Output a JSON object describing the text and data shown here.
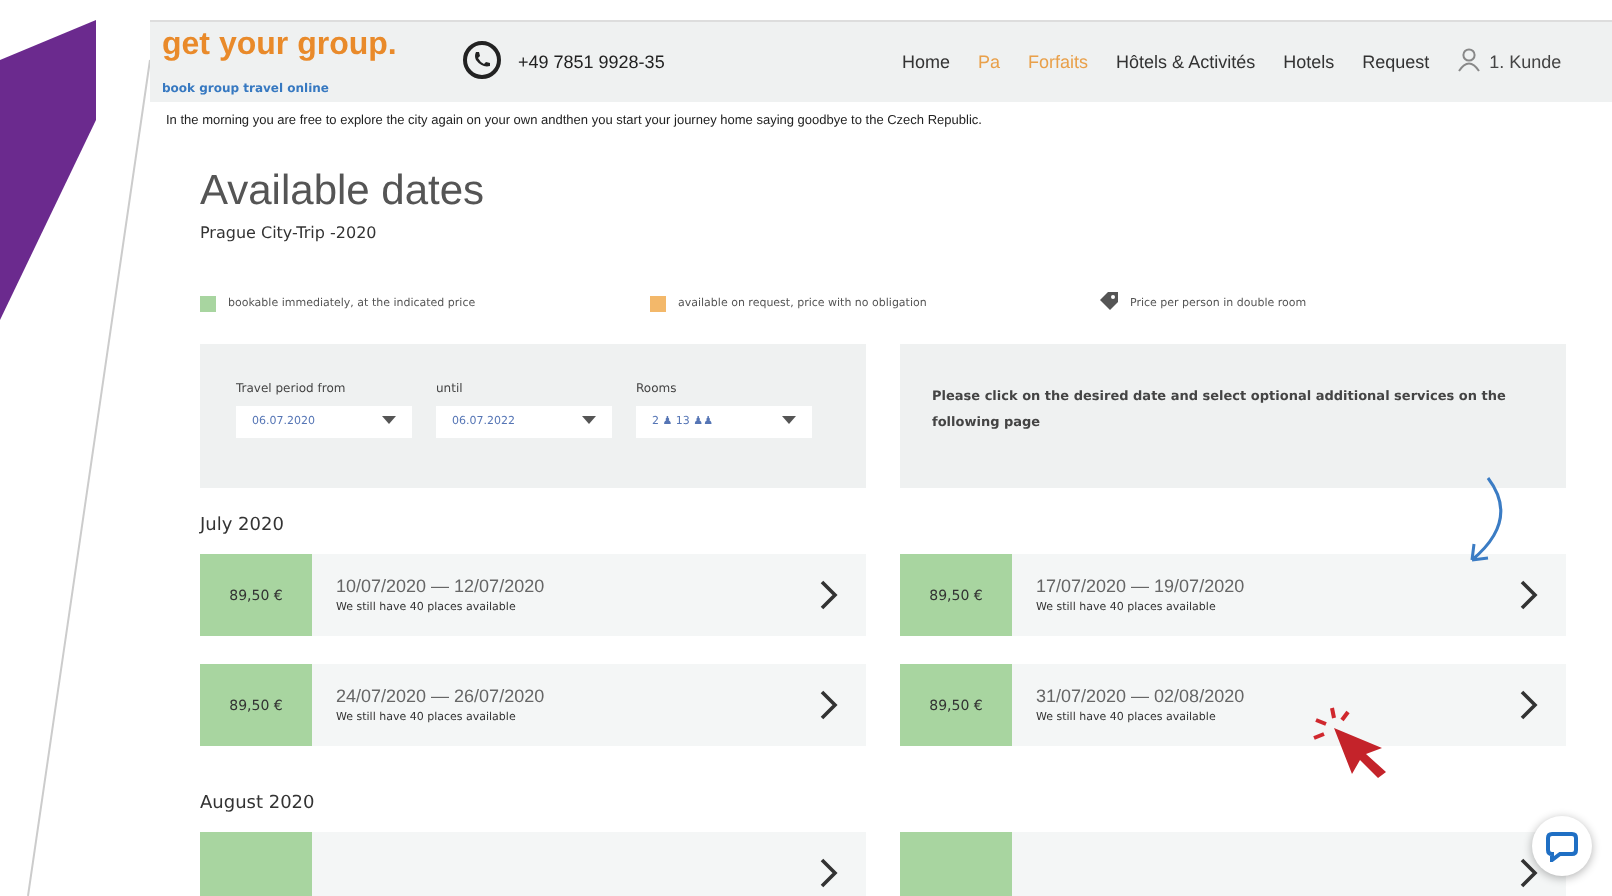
{
  "header": {
    "logo": {
      "title": "get your group.",
      "tagline": "book group travel online"
    },
    "phone": "+49 7851 9928-35",
    "nav": [
      {
        "label": "Home",
        "highlighted": false
      },
      {
        "label": "Pa",
        "highlighted": true
      },
      {
        "label": "Forfaits",
        "highlighted": true
      },
      {
        "label": "Hôtels & Activités",
        "highlighted": false
      },
      {
        "label": "Hotels",
        "highlighted": false
      },
      {
        "label": "Request",
        "highlighted": false
      }
    ],
    "account": "1. Kunde"
  },
  "intro": "In the morning you are free to explore the city again on your own andthen you start your journey home saying goodbye to the Czech Republic.",
  "title": "Available dates",
  "subtitle": "Prague City-Trip -2020",
  "legend": [
    {
      "kind": "swatch",
      "color": "#a8d5a0",
      "label": "bookable immediately, at the indicated price"
    },
    {
      "kind": "swatch",
      "color": "#f3b86a",
      "label": "available on request, price with no obligation"
    },
    {
      "kind": "tag",
      "label": "Price per person in double room"
    }
  ],
  "filters": [
    {
      "label": "Travel period from",
      "value": "06.07.2020"
    },
    {
      "label": "until",
      "value": "06.07.2022"
    },
    {
      "label": "Rooms",
      "value": "2 ♟  13 ♟♟"
    }
  ],
  "hint": "Please click on the desired date and select optional additional services on the following page",
  "months": [
    {
      "label": "July 2020",
      "dates": [
        {
          "price": "89,50 €",
          "range": "10/07/2020 — 12/07/2020",
          "places": "We still have 40 places available",
          "color": "#a8d5a0"
        },
        {
          "price": "89,50 €",
          "range": "17/07/2020 — 19/07/2020",
          "places": "We still have 40 places available",
          "color": "#a8d5a0"
        },
        {
          "price": "89,50 €",
          "range": "24/07/2020 — 26/07/2020",
          "places": "We still have 40 places available",
          "color": "#a8d5a0"
        },
        {
          "price": "89,50 €",
          "range": "31/07/2020 — 02/08/2020",
          "places": "We still have 40 places available",
          "color": "#a8d5a0"
        }
      ]
    },
    {
      "label": "August 2020",
      "dates": [
        {
          "color": "#a8d5a0"
        },
        {
          "color": "#a8d5a0"
        }
      ]
    }
  ]
}
